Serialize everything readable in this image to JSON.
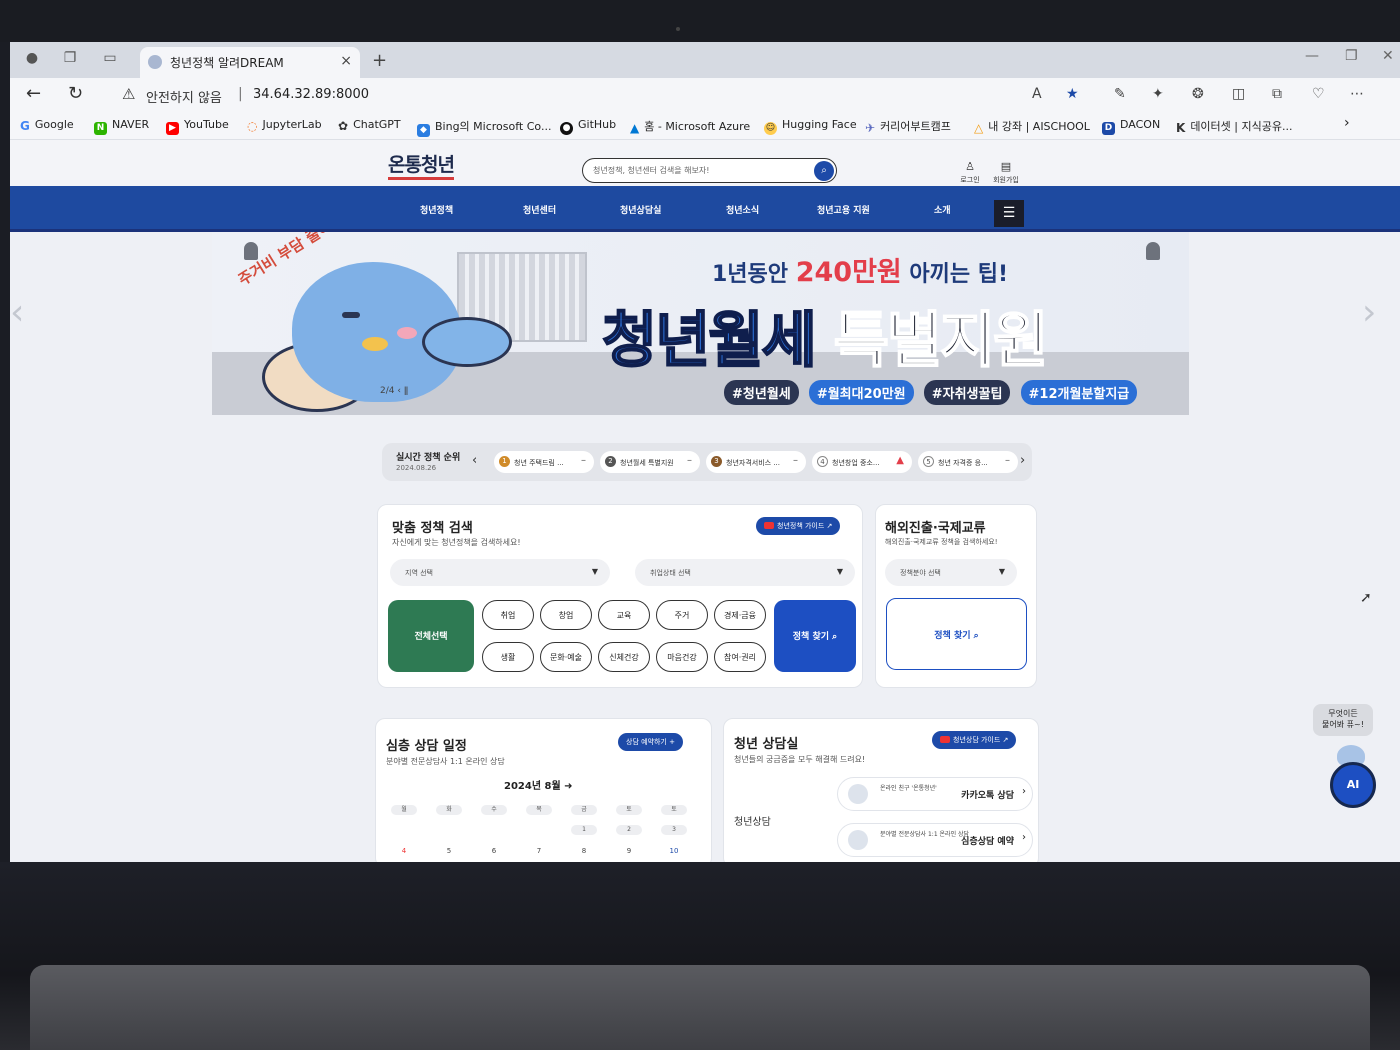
{
  "browser": {
    "tab_title": "청년정책 알려DREAM",
    "tab_close": "×",
    "new_tab": "+",
    "insecure_label": "안전하지 않음",
    "url": "34.64.32.89:8000",
    "bookmarks": [
      {
        "label": "Google",
        "icon_color": "#ffffff"
      },
      {
        "label": "NAVER",
        "icon_color": "#2db400"
      },
      {
        "label": "YouTube",
        "icon_color": "#ff0000"
      },
      {
        "label": "JupyterLab",
        "icon_color": "#f37726"
      },
      {
        "label": "ChatGPT",
        "icon_color": "#333333"
      },
      {
        "label": "Bing의 Microsoft Co...",
        "icon_color": "#2a7de1"
      },
      {
        "label": "GitHub",
        "icon_color": "#111111"
      },
      {
        "label": "홈 - Microsoft Azure",
        "icon_color": "#0078d4"
      },
      {
        "label": "Hugging Face",
        "icon_color": "#ffcc4d"
      },
      {
        "label": "커리어부트캠프",
        "icon_color": "#5c6bc0"
      },
      {
        "label": "내 강좌 | AISCHOOL",
        "icon_color": "#f39c12"
      },
      {
        "label": "DACON",
        "icon_color": "#1d4aa8"
      },
      {
        "label": "데이터셋 | 지식공유...",
        "icon_color": "#333333"
      }
    ]
  },
  "site": {
    "logo": "온통청년",
    "search_placeholder": "청년정책, 청년센터 검색을 해보자!",
    "login": "로그인",
    "signup": "회원가입",
    "nav": [
      "청년정책",
      "청년센터",
      "청년상담실",
      "청년소식",
      "청년고용 지원",
      "소개"
    ]
  },
  "banner": {
    "arc_text": "주거비 부담 줄여~",
    "subtitle_pre": "1년동안",
    "subtitle_highlight": "240만원",
    "subtitle_post": "아끼는 팁!",
    "title_part1": "청년월세",
    "title_part2": "특별지원",
    "tags": [
      {
        "label": "#청년월세",
        "color": "#2b3552"
      },
      {
        "label": "#월최대20만원",
        "color": "#2b6fd6"
      },
      {
        "label": "#자취생꿀팁",
        "color": "#2b3552"
      },
      {
        "label": "#12개월분할지급",
        "color": "#2b6fd6"
      }
    ],
    "pager": "2/4"
  },
  "ranking": {
    "title": "실시간 정책 순위",
    "date": "2024.08.26",
    "items": [
      {
        "rank": "1",
        "label": "청년 주택드림 ...",
        "trend": "–"
      },
      {
        "rank": "2",
        "label": "청년월세 특별지원",
        "trend": "–"
      },
      {
        "rank": "3",
        "label": "청년자격서비스 ...",
        "trend": "–"
      },
      {
        "rank": "4",
        "label": "청년창업 중소...",
        "trend": "▲"
      },
      {
        "rank": "5",
        "label": "청년 자격증 응...",
        "trend": "–"
      }
    ]
  },
  "policy_search": {
    "title": "맞춤 정책 검색",
    "desc": "자신에게 맞는 청년정책을 검색하세요!",
    "guide": "청년정책 가이드",
    "region_select": "지역 선택",
    "employment_select": "취업상태 선택",
    "all_label": "전체선택",
    "categories": [
      "취업",
      "창업",
      "교육",
      "주거",
      "경제·금융",
      "생활",
      "문화·예술",
      "신체건강",
      "마음건강",
      "참여·권리"
    ],
    "find_label": "정책 찾기"
  },
  "overseas": {
    "title": "해외진출·국제교류",
    "desc": "해외진출·국제교류 정책을 검색하세요!",
    "field_select": "정책분야 선택",
    "find_label": "정책 찾기"
  },
  "schedule": {
    "title": "심층 상담 일정",
    "desc": "분야별 전문상담사 1:1 온라인 상담",
    "reserve_btn": "상담 예약하기",
    "month": "2024년 8월",
    "weekdays": [
      "월",
      "화",
      "수",
      "목",
      "금",
      "토"
    ],
    "row1": [
      "",
      "",
      "",
      "1",
      "2",
      "3"
    ],
    "row2": [
      "4",
      "5",
      "6",
      "7",
      "8",
      "9",
      "10"
    ]
  },
  "counsel": {
    "title": "청년 상담실",
    "desc": "청년들의 궁금증을 모두 해결해 드려요!",
    "guide": "청년상담 가이드",
    "section_label": "청년상담",
    "rows": [
      {
        "small": "온라인 친구 '온통청년'",
        "label": "카카오톡 상담"
      },
      {
        "small": "분야별 전문상담사 1:1 온라인 상담",
        "label": "심층상담 예약"
      }
    ]
  },
  "ai": {
    "bubble_line1": "무엇이든",
    "bubble_line2": "물어봐 퓨~!",
    "label": "AI"
  }
}
